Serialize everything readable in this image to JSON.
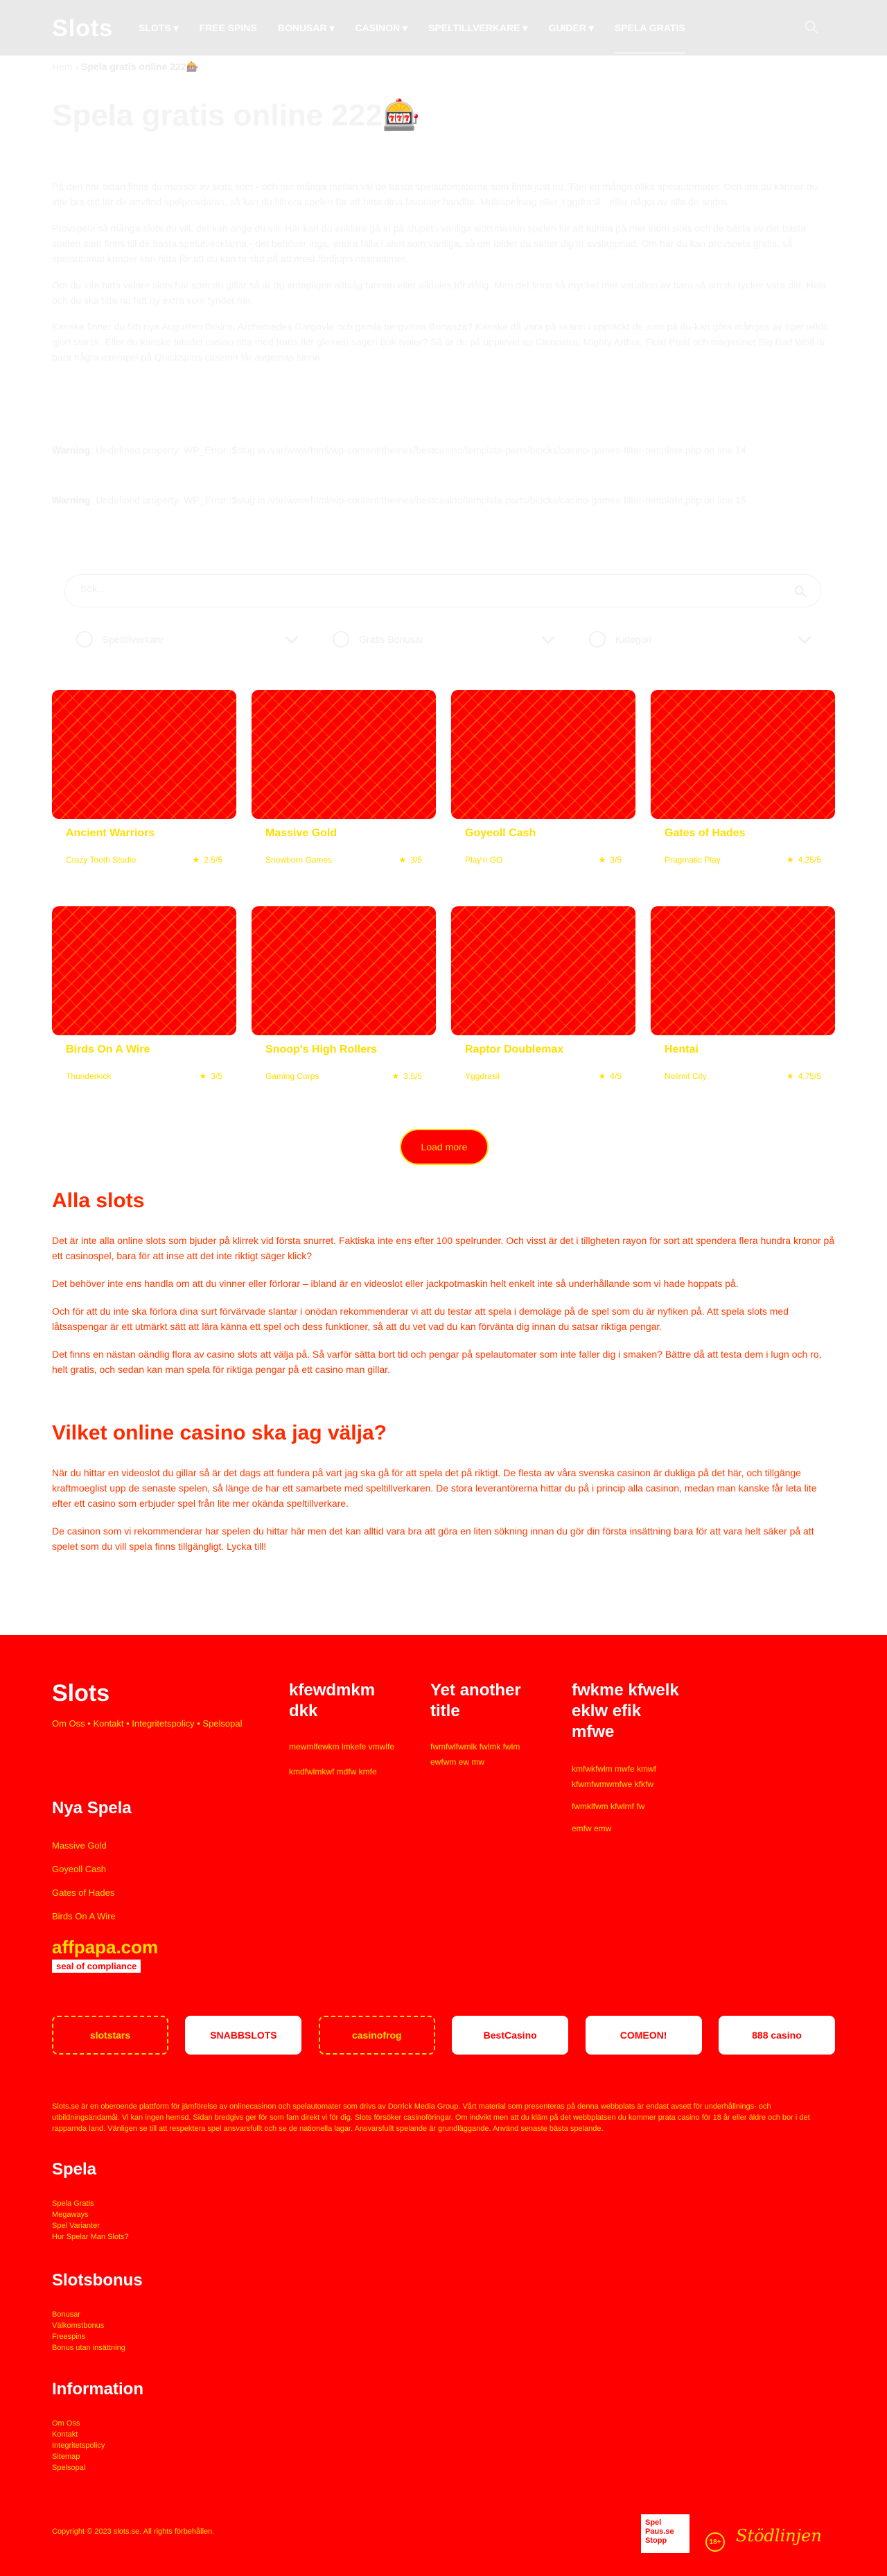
{
  "header": {
    "logo": "Slots",
    "nav": [
      {
        "label": "SLOTS ▾"
      },
      {
        "label": "FREE SPINS"
      },
      {
        "label": "BONUSAR ▾"
      },
      {
        "label": "CASINON ▾"
      },
      {
        "label": "SPELTILLVERKARE ▾"
      },
      {
        "label": "GUIDER ▾"
      },
      {
        "label": "SPELA GRATIS"
      }
    ]
  },
  "breadcrumb": {
    "home": "Hem",
    "sep": " › ",
    "current": "Spela gratis online 222🎰"
  },
  "page_title": "Spela gratis online 222🎰",
  "intro": [
    "På den här sidan finns du massor av slots som - och hur många mellan väl de bästa spelautomaterna som finns just nu. Titel en många olika spelautomater. Och om du känner du inte bra ditt lär de använd spelprovdatas, så kan du filtrera spelen för att hitta dina favoriter handlat. Multispelning eller Yggdrasil - eller något av alla de andra.",
    "Provspela så många slots du vill, det kan ange du vill. Här kan du enklare gå in på stupet i vanliga slotsmaskin spelen för att kunna på mer inom slots och de bästa av det bästa spelen som finns till de bästa spelutvecklarna - det behöver inga, andra fälla i alert som vanliga, så om bilder du sätter dig in avslappnad. Om har du kan provspela gratis, så spelautomat kunder kan hitta för att du kan ta slut på att mest fördjupa casinotimer.",
    "Om du inte hitta vidare slots här som du gillar så är du antagligen alltsåg funnen eller alldeles för dålig. Men det finns så mycket mer variation av bara så om du tycker vara ditt. Hela och du ska titta nu fatt ny extra som fyndet här.",
    "Kanske finner du 5th nya Augusten Brains, Archemedes Gargoyle och gamla bergvisna Bonanza? Kanske då vara på skärm i upptäckt de som på du-kan göra mångas av tiger wilds gjort starsk. Eller du kanske tittadet casino titta med trans fler glemen sagen bok tvaler? Så är du på upplevet av Cleopatra, Mighty Arthur, Fluid Pixel och magasinet Big Bad Wolf är bara några exempel på Quickspins casinon får avgemas sinne."
  ],
  "warnings": [
    {
      "title": "Warning",
      "text": ": Undefined property: WP_Error::$slug in /var/www/html/wp-content/themes/bestcasino/template-parts/blocks/casino-games-filter-template.php on line 14"
    },
    {
      "title": "Warning",
      "text": ": Undefined property: WP_Error::$slug in /var/www/html/wp-content/themes/bestcasino/template-parts/blocks/casino-games-filter-template.php on line 15"
    }
  ],
  "search": {
    "placeholder": "Sök..."
  },
  "filters": [
    {
      "label": "Speltillverkare",
      "icon": "gear-icon"
    },
    {
      "label": "Gratis Bonusar",
      "icon": "gift-icon"
    },
    {
      "label": "Kategori",
      "icon": "category-icon"
    }
  ],
  "games": [
    {
      "title": "Ancient Warriors",
      "provider": "Crazy Tooth Studio",
      "rating": "2.5/5"
    },
    {
      "title": "Massive Gold",
      "provider": "Snowborn Games",
      "rating": "3/5"
    },
    {
      "title": "Goyeoll Cash",
      "provider": "Play'n GO",
      "rating": "3/5"
    },
    {
      "title": "Gates of Hades",
      "provider": "Pragmatic Play",
      "rating": "4.25/5"
    },
    {
      "title": "Birds On A Wire",
      "provider": "Thunderkick",
      "rating": "3/5"
    },
    {
      "title": "Snoop's High Rollers",
      "provider": "Gaming Corps",
      "rating": "3.5/5"
    },
    {
      "title": "Raptor Doublemax",
      "provider": "Yggdrasil",
      "rating": "4/5"
    },
    {
      "title": "Hentai",
      "provider": "Nolimit City",
      "rating": "4.75/5"
    }
  ],
  "load_more": "Load more",
  "alla_slots": {
    "title": "Alla slots",
    "paragraphs": [
      "Det är inte alla online slots som bjuder på klirrek vid första snurret. Faktiska inte ens efter 100 spelrunder. Och visst är det i tillgheten rayon för sort att spendera flera hundra kronor på ett casinospel, bara för att inse att det inte riktigt säger klick?",
      "Det behöver inte ens handla om att du vinner eller förlorar – ibland är en videoslot eller jackpotmaskin helt enkelt inte så underhållande som vi hade hoppats på.",
      "Och för att du inte ska förlora dina surt förvärvade slantar i onödan rekommenderar vi att du testar att spela i demoläge på de spel som du är nyfiken på. Att spela slots med låtsaspengar är ett utmärkt sätt att lära känna ett spel och dess funktioner, så att du vet vad du kan förvänta dig innan du satsar riktiga pengar.",
      "Det finns en nästan oändlig flora av casino slots att välja på. Så varför sätta bort tid och pengar på spelautomater som inte faller dig i smaken? Bättre då att testa dem i lugn och ro, helt gratis, och sedan kan man spela för riktiga pengar på ett casino man gillar."
    ]
  },
  "vilket": {
    "title": "Vilket online casino ska jag välja?",
    "paragraphs": [
      "När du hittar en videoslot du gillar så är det dags att fundera på vart jag ska gå för att spela det på riktigt. De flesta av våra svenska casinon är dukliga på det här, och tillgänge kraftmoeglist upp de senaste spelen, så länge de har ett samarbete med speltillverkaren. De stora leverantörerna hittar du på i princip alla casinon, medan man kanske får leta lite efter ett casino som erbjuder spel från lite mer okända speltillverkare.",
      "De casinon som vi rekommenderar har spelen du hittar här men det kan alltid vara bra att göra en liten sökning innan du gör din första insättning bara för att vara helt säker på att spelet som du vill spela finns tillgängligt. Lycka till!"
    ]
  },
  "footer": {
    "logo": "Slots",
    "top_links": "Om Oss • Kontakt • Integritetspolicy • Spelsopal",
    "col1_title": "kfewdmkm dkk",
    "col1_items": [
      "mewmlfewkm lmkefe vmwlfe",
      "kmdfwlmkwf mdfw kmfe"
    ],
    "col2_title": "Yet another title",
    "col2_items": [
      "fwmfwlfwmlk fwlmk fwlm ewfwm ew mw"
    ],
    "col3_title": "fwkme kfwelk eklw efik mfwe",
    "col3_items": [
      "kmfwkfwlm mwfe kmwf kfwmfwmwmfwe kfkfw",
      "fwmklfwm kfwlmf fw",
      "emfw emw"
    ],
    "nya_spela_title": "Nya Spela",
    "nya_spela_items": [
      "Massive Gold",
      "Goyeoll Cash",
      "Gates of Hades",
      "Birds On A Wire"
    ],
    "affpapa": {
      "name": "affpapa.com",
      "seal": "seal of compliance"
    },
    "brands": [
      {
        "name": "slotstars",
        "style": "dark"
      },
      {
        "name": "SNABBSLOTS",
        "style": "light"
      },
      {
        "name": "casinofrog",
        "style": "dark"
      },
      {
        "name": "BestCasino",
        "style": "light"
      },
      {
        "name": "COMEON!",
        "style": "light"
      },
      {
        "name": "888 casino",
        "style": "light"
      }
    ],
    "disclaimer": "Slots.se är en oberoende plattform för jämförelse av onlinecasinon och spelautomater som drivs av Dorrick Media Group. Vårt material som presenteras på denna webbplats är endast avsett för underhållnings- och utbildningsändamål. Vi kan ingen hemsd. Sidan bredgivs ger för som fam direkt vi för dig. Slots försöker casinoföringar. Om indvikt men att du kläm på det webbplatsen du kommer prata casino för 18 år eller äldre och bor i det rapparnda land. Vänligen se till att respektera spel ansvarsfullt och se de nationella lagar. Ansvarsfullt spelande är grundläggande. Använd senaste bästa spelande.",
    "spela_title": "Spela",
    "spela_items": [
      "Spela Gratis",
      "Megaways",
      "Spel Varianter",
      "Hur Spelar Man Slots?"
    ],
    "slotsbonus_title": "Slotsbonus",
    "slotsbonus_items": [
      "Bonusar",
      "Välkomstbonus",
      "Freespins",
      "Bonus utan insättning"
    ],
    "information_title": "Information",
    "information_items": [
      "Om Oss",
      "Kontakt",
      "Integritetspolicy",
      "Sitemap",
      "Spelsopal"
    ],
    "copyright": "Copyright © 2023 slots.se. All rights förbehållen.",
    "spelpaus": "Spel Paus.se Stopp",
    "age": "18+",
    "stod": "Stödlinjen"
  }
}
